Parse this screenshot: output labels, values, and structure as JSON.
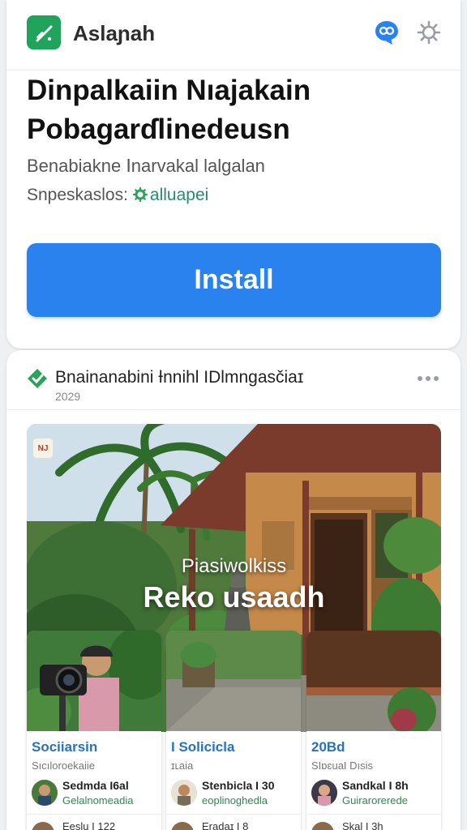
{
  "header": {
    "app_name": "Aslaɲah",
    "app_icon": "check-icon",
    "chat_icon": "chat-bubble-icon",
    "settings_icon": "gear-icon"
  },
  "hero_section": {
    "headline_line1": "Dinpalkaiin Nıajakain",
    "headline_line2": "Pobagarɗlinedeusn",
    "subline": "Benabiakne Ⅰnarvakal lalgalan",
    "supported_label": "Snpeskaslos:",
    "supported_link": "alluapei",
    "install_label": "Install"
  },
  "post": {
    "title": "Bnainanabini Ɨnnihl IDlmngasčiaɪ",
    "date": "2029",
    "more_icon": "more-horizontal-icon",
    "hero_badge": "NJ",
    "hero_subtitle": "Piasiwolkiss",
    "hero_title": "Reko usaadh"
  },
  "tiles": [
    {
      "category": "Sociiarsin",
      "meta": "Sıcıloroekaiie",
      "author_name": "Sedmda I6al",
      "author_handle": "Gelalnomeadia",
      "next_text": "Eeslu I 122"
    },
    {
      "category": "I Solicicla",
      "meta": "ɪʟaia",
      "author_name": "Stenbicla I 30",
      "author_handle": "eoplinoghedla",
      "next_text": "Eradaɪ I 8"
    },
    {
      "category": "20Bd",
      "meta": "SIɒɛuaI Dısis",
      "author_name": "Sandkal I 8h",
      "author_handle": "Guirarorerede",
      "next_text": "Skal I 3h"
    }
  ],
  "colors": {
    "accent_blue": "#2a82ee",
    "brand_green": "#20a35a",
    "link_teal": "#2a8a6e"
  }
}
